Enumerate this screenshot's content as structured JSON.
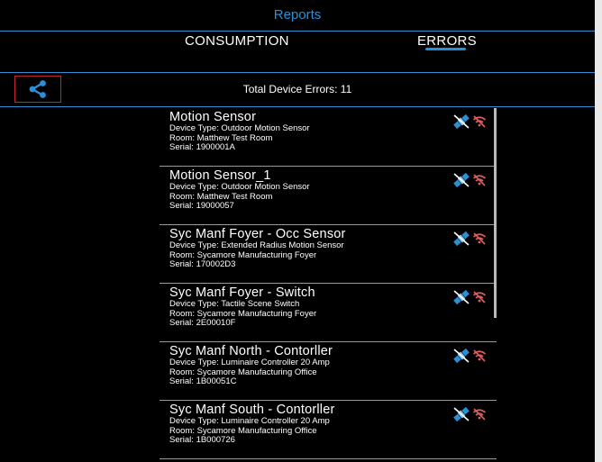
{
  "header": {
    "title": "Reports"
  },
  "tabs": [
    {
      "label": "CONSUMPTION"
    },
    {
      "label": "ERRORS"
    }
  ],
  "toolbar": {
    "total_label": "Total Device Errors: 11"
  },
  "colors": {
    "accent": "#2b8fd6",
    "error_icon": "#e0605e",
    "satellite_icon": "#2b8fd6",
    "share_border": "#c0282b"
  },
  "icons": {
    "share": "share-icon",
    "satellite": "satellite-icon",
    "no_wifi": "no-wifi-icon"
  },
  "devices": [
    {
      "name": "Motion Sensor",
      "type": "Device Type: Outdoor Motion Sensor",
      "room": "Room: Matthew Test Room",
      "serial": "Serial: 1900001A"
    },
    {
      "name": "Motion Sensor_1",
      "type": "Device Type: Outdoor Motion Sensor",
      "room": "Room: Matthew Test Room",
      "serial": "Serial: 19000057"
    },
    {
      "name": "Syc Manf Foyer - Occ Sensor",
      "type": "Device Type: Extended Radius Motion Sensor",
      "room": "Room: Sycamore Manufacturing Foyer",
      "serial": "Serial: 170002D3"
    },
    {
      "name": "Syc Manf Foyer - Switch",
      "type": "Device Type: Tactile Scene Switch",
      "room": "Room: Sycamore Manufacturing Foyer",
      "serial": "Serial: 2E00010F"
    },
    {
      "name": "Syc Manf North - Contorller",
      "type": "Device Type: Luminaire Controller 20 Amp",
      "room": "Room: Sycamore Manufacturing Office",
      "serial": "Serial: 1B00051C"
    },
    {
      "name": "Syc Manf South - Contorller",
      "type": "Device Type: Luminaire Controller 20 Amp",
      "room": "Room: Sycamore Manufacturing Office",
      "serial": "Serial: 1B000726"
    }
  ]
}
